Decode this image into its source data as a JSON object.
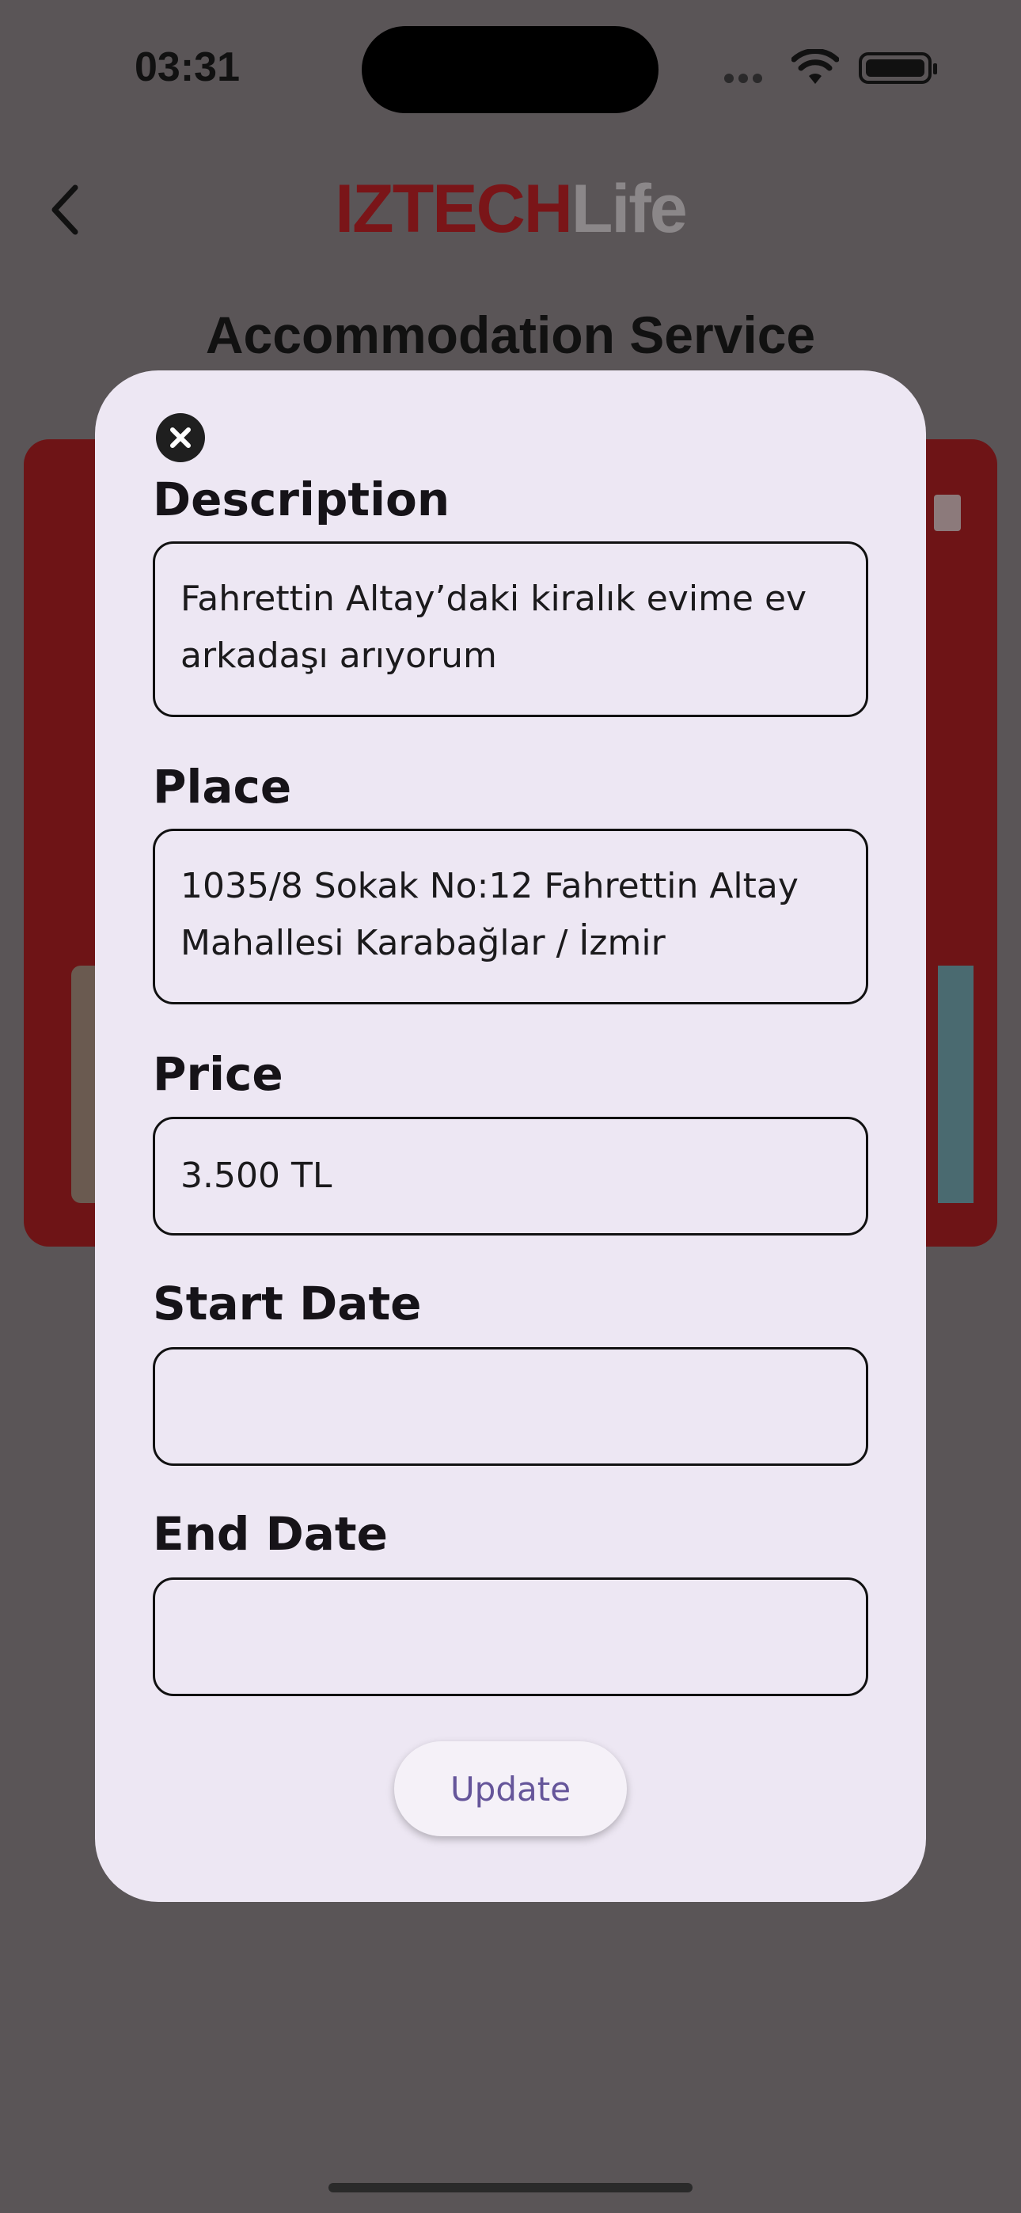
{
  "status_bar": {
    "time": "03:31"
  },
  "header": {
    "brand_part1": "IZTECH",
    "brand_part2": "Life",
    "title": "Accommodation Service"
  },
  "modal": {
    "fields": [
      {
        "label": "Description",
        "value": "Fahrettin Altay’daki kiralık evime ev\narkadaşı arıyorum"
      },
      {
        "label": "Place",
        "value": "1035/8 Sokak No:12 Fahrettin Altay\nMahallesi Karabağlar / İzmir"
      },
      {
        "label": "Price",
        "value": "3.500 TL"
      },
      {
        "label": "Start Date",
        "value": ""
      },
      {
        "label": "End Date",
        "value": ""
      }
    ],
    "update_label": "Update"
  },
  "colors": {
    "brand_red": "#7a1518",
    "card_red": "#6e1416",
    "modal_bg": "#ede7f3",
    "button_text": "#65559a"
  }
}
